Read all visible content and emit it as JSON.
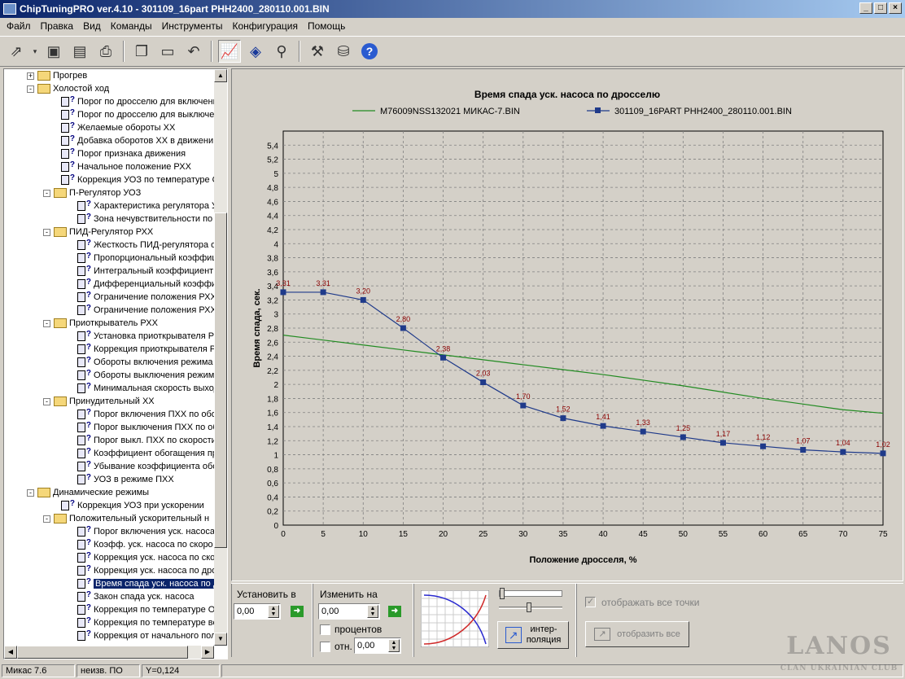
{
  "window": {
    "title": "ChipTuningPRO ver.4.10 - 301109_16part PHH2400_280110.001.BIN"
  },
  "menu": [
    "Файл",
    "Правка",
    "Вид",
    "Команды",
    "Инструменты",
    "Конфигурация",
    "Помощь"
  ],
  "toolbar": {
    "icons": [
      "open-icon",
      "save-icon",
      "save-as-icon",
      "print-icon",
      "copy-icon",
      "paste-icon",
      "undo-icon",
      "chart-icon",
      "info-icon",
      "search-icon",
      "tools-icon",
      "network-icon",
      "help-icon"
    ]
  },
  "tree": [
    {
      "level": 0,
      "kind": "folder",
      "exp": "+",
      "label": "Прогрев"
    },
    {
      "level": 0,
      "kind": "folder",
      "exp": "-",
      "label": "Холостой ход"
    },
    {
      "level": 1,
      "kind": "param",
      "label": "Порог по дросселю для включени"
    },
    {
      "level": 1,
      "kind": "param",
      "label": "Порог по дросселю для выключен"
    },
    {
      "level": 1,
      "kind": "param",
      "label": "Желаемые обороты ХХ"
    },
    {
      "level": 1,
      "kind": "param",
      "label": "Добавка оборотов ХХ в движени"
    },
    {
      "level": 1,
      "kind": "param",
      "label": "Порог признака движения"
    },
    {
      "level": 1,
      "kind": "param",
      "label": "Начальное положение РХХ"
    },
    {
      "level": 1,
      "kind": "param",
      "label": "Коррекция УОЗ по температуре О"
    },
    {
      "level": 1,
      "kind": "folder",
      "exp": "-",
      "label": "П-Регулятор УОЗ"
    },
    {
      "level": 2,
      "kind": "param",
      "label": "Характеристика регулятора У"
    },
    {
      "level": 2,
      "kind": "param",
      "label": "Зона нечувствительности по о"
    },
    {
      "level": 1,
      "kind": "folder",
      "exp": "-",
      "label": "ПИД-Регулятор РХХ"
    },
    {
      "level": 2,
      "kind": "param",
      "label": "Жесткость ПИД-регулятора о"
    },
    {
      "level": 2,
      "kind": "param",
      "label": "Пропорциональный коэффици"
    },
    {
      "level": 2,
      "kind": "param",
      "label": "Интегральный коэффициент р"
    },
    {
      "level": 2,
      "kind": "param",
      "label": "Дифференциальный коэффиц"
    },
    {
      "level": 2,
      "kind": "param",
      "label": "Ограничение положения РХХ"
    },
    {
      "level": 2,
      "kind": "param",
      "label": "Ограничение положения РХХ"
    },
    {
      "level": 1,
      "kind": "folder",
      "exp": "-",
      "label": "Приоткрыватель РХХ"
    },
    {
      "level": 2,
      "kind": "param",
      "label": "Установка приоткрывателя Р"
    },
    {
      "level": 2,
      "kind": "param",
      "label": "Коррекция приоткрывателя Р"
    },
    {
      "level": 2,
      "kind": "param",
      "label": "Обороты включения режима п"
    },
    {
      "level": 2,
      "kind": "param",
      "label": "Обороты выключения режима"
    },
    {
      "level": 2,
      "kind": "param",
      "label": "Минимальная скорость выход"
    },
    {
      "level": 1,
      "kind": "folder",
      "exp": "-",
      "label": "Принудительный ХХ"
    },
    {
      "level": 2,
      "kind": "param",
      "label": "Порог включения ПХХ по обор"
    },
    {
      "level": 2,
      "kind": "param",
      "label": "Порог выключения ПХХ по об"
    },
    {
      "level": 2,
      "kind": "param",
      "label": "Порог выкл. ПХХ по скорости"
    },
    {
      "level": 2,
      "kind": "param",
      "label": "Коэффициент обогащения при"
    },
    {
      "level": 2,
      "kind": "param",
      "label": "Убывание коэффициента обо"
    },
    {
      "level": 2,
      "kind": "param",
      "label": "УОЗ в режиме ПХХ"
    },
    {
      "level": 0,
      "kind": "folder",
      "exp": "-",
      "label": "Динамические режимы"
    },
    {
      "level": 1,
      "kind": "param",
      "label": "Коррекция УОЗ при ускорении"
    },
    {
      "level": 1,
      "kind": "folder",
      "exp": "-",
      "label": "Положительный ускорительный н"
    },
    {
      "level": 2,
      "kind": "param",
      "label": "Порог включения уск. насоса"
    },
    {
      "level": 2,
      "kind": "param",
      "label": "Коэфф. уск. насоса по скоро"
    },
    {
      "level": 2,
      "kind": "param",
      "label": "Коррекция уск. насоса по ско"
    },
    {
      "level": 2,
      "kind": "param",
      "label": "Коррекция уск. насоса по дро"
    },
    {
      "level": 2,
      "kind": "param",
      "label": "Время спада уск. насоса по д",
      "selected": true
    },
    {
      "level": 2,
      "kind": "param",
      "label": "Закон спада уск. насоса"
    },
    {
      "level": 2,
      "kind": "param",
      "label": "Коррекция по температуре ОХ"
    },
    {
      "level": 2,
      "kind": "param",
      "label": "Коррекция по температуре вс"
    },
    {
      "level": 2,
      "kind": "param",
      "label": "Коррекция от начального пол"
    }
  ],
  "chart_data": {
    "type": "line",
    "title": "Время спада уск. насоса по дросселю",
    "xlabel": "Положение дросселя, %",
    "ylabel": "Время спада, сек.",
    "x": [
      0,
      5,
      10,
      15,
      20,
      25,
      30,
      35,
      40,
      45,
      50,
      55,
      60,
      65,
      70,
      75
    ],
    "xlim": [
      0,
      75
    ],
    "ylim": [
      0,
      5.6
    ],
    "yticks": [
      "0",
      "0,2",
      "0,4",
      "0,6",
      "0,8",
      "1",
      "1,2",
      "1,4",
      "1,6",
      "1,8",
      "2",
      "2,2",
      "2,4",
      "2,6",
      "2,8",
      "3",
      "3,2",
      "3,4",
      "3,6",
      "3,8",
      "4",
      "4,2",
      "4,4",
      "4,6",
      "4,8",
      "5",
      "5,2",
      "5,4"
    ],
    "xticks": [
      "0",
      "5",
      "10",
      "15",
      "20",
      "25",
      "30",
      "35",
      "40",
      "45",
      "50",
      "55",
      "60",
      "65",
      "70",
      "75"
    ],
    "grid": true,
    "legend": "top",
    "series": [
      {
        "name": "M76009NSS132021 МИКАС-7.BIN",
        "color": "#228b22",
        "values": [
          2.7,
          2.63,
          2.56,
          2.49,
          2.42,
          2.35,
          2.28,
          2.21,
          2.14,
          2.06,
          1.98,
          1.89,
          1.8,
          1.72,
          1.64,
          1.59
        ],
        "markers": false
      },
      {
        "name": "301109_16PART PHH2400_280110.001.BIN",
        "color": "#1f3a8a",
        "values": [
          3.31,
          3.31,
          3.2,
          2.8,
          2.38,
          2.03,
          1.7,
          1.52,
          1.41,
          1.33,
          1.25,
          1.17,
          1.12,
          1.07,
          1.04,
          1.02
        ],
        "labels": [
          "3,31",
          "3,31",
          "3,20",
          "2,80",
          "2,38",
          "2,03",
          "1,70",
          "1,52",
          "1,41",
          "1,33",
          "1,25",
          "1,17",
          "1,12",
          "1,07",
          "1,04",
          "1,02"
        ],
        "markers": true
      }
    ]
  },
  "controls": {
    "set_label": "Установить в",
    "set_value": "0,00",
    "change_label": "Изменить на",
    "change_value": "0,00",
    "percent_label": "процентов",
    "rel_label": "отн.",
    "rel_value": "0,00",
    "interp_label1": "интер-",
    "interp_label2": "поляция",
    "show_all_points": "отображать все точки",
    "show_all": "отобразить все"
  },
  "status": {
    "mode": "Микас 7.6",
    "state": "неизв. ПО",
    "y": "Y=0,124"
  },
  "watermark": {
    "big": "LANOS",
    "small": "CLAN UKRAINIAN CLUB"
  }
}
